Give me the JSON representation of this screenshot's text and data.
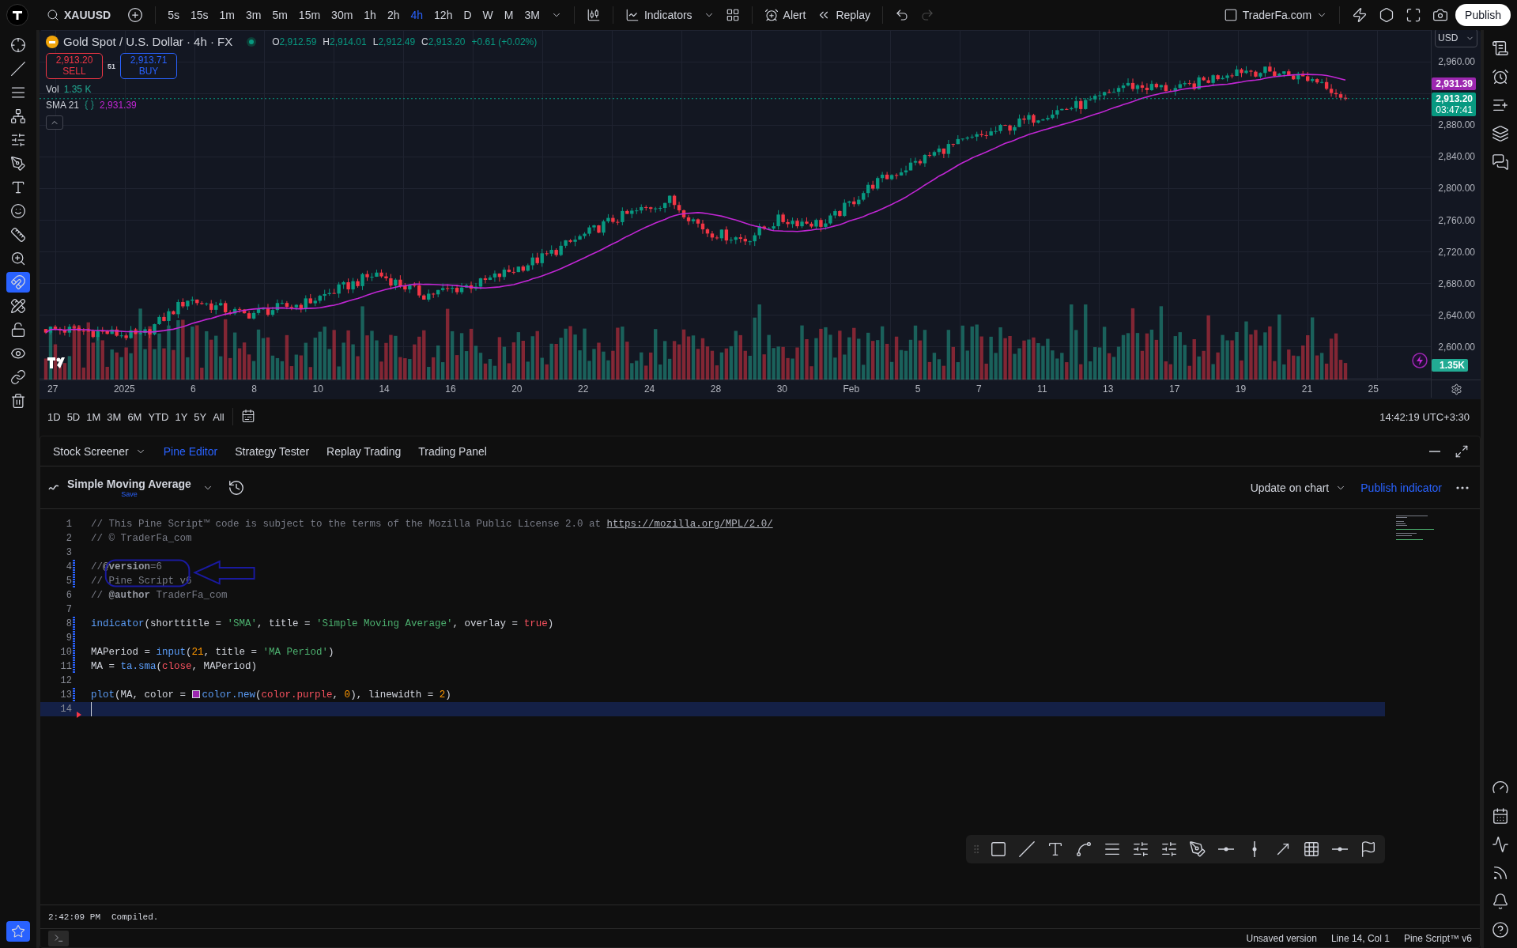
{
  "toolbar": {
    "symbol": "XAUUSD",
    "intervals": [
      {
        "label": "5s",
        "selected": false
      },
      {
        "label": "15s",
        "selected": false
      },
      {
        "label": "1m",
        "selected": false
      },
      {
        "label": "3m",
        "selected": false
      },
      {
        "label": "5m",
        "selected": false
      },
      {
        "label": "15m",
        "selected": false
      },
      {
        "label": "30m",
        "selected": false
      },
      {
        "label": "1h",
        "selected": false
      },
      {
        "label": "2h",
        "selected": false
      },
      {
        "label": "4h",
        "selected": true
      },
      {
        "label": "12h",
        "selected": false
      },
      {
        "label": "D",
        "selected": false
      },
      {
        "label": "W",
        "selected": false
      },
      {
        "label": "M",
        "selected": false
      },
      {
        "label": "3M",
        "selected": false
      }
    ],
    "indicators": "Indicators",
    "alert": "Alert",
    "replay": "Replay",
    "layout_name": "TraderFa.com",
    "publish": "Publish"
  },
  "legend": {
    "title": "Gold Spot / U.S. Dollar · 4h · FX",
    "ohlc": [
      {
        "label": "O",
        "value": "2,912.59"
      },
      {
        "label": "H",
        "value": "2,914.01"
      },
      {
        "label": "L",
        "value": "2,912.49"
      },
      {
        "label": "C",
        "value": "2,913.20"
      }
    ],
    "change": "+0.61 (+0.02%)",
    "sell": {
      "price": "2,913.20",
      "label": "SELL"
    },
    "spread": "51",
    "buy": {
      "price": "2,913.71",
      "label": "BUY"
    },
    "volume": {
      "label": "Vol",
      "value": "1.35 K"
    },
    "sma": {
      "label": "SMA 21",
      "value": "2,931.39"
    }
  },
  "price_axis": {
    "currency": "USD",
    "ticks": [
      "2,960.00",
      "2,880.00",
      "2,840.00",
      "2,800.00",
      "2,760.00",
      "2,720.00",
      "2,680.00",
      "2,640.00",
      "2,600.00"
    ],
    "sma_tag": "2,931.39",
    "last_price": "2,913.20",
    "countdown": "03:47:41",
    "volume_tag": "1.35K"
  },
  "time_axis": [
    "27",
    "2025",
    "6",
    "8",
    "10",
    "14",
    "16",
    "20",
    "22",
    "24",
    "28",
    "30",
    "Feb",
    "5",
    "7",
    "11",
    "13",
    "17",
    "19",
    "21",
    "25"
  ],
  "ranges": [
    "1D",
    "5D",
    "1M",
    "3M",
    "6M",
    "YTD",
    "1Y",
    "5Y",
    "All"
  ],
  "clock": "14:42:19 UTC+3:30",
  "bottom_tabs": [
    {
      "label": "Stock Screener",
      "selected": false,
      "dropdown": true
    },
    {
      "label": "Pine Editor",
      "selected": true,
      "dropdown": false
    },
    {
      "label": "Strategy Tester",
      "selected": false,
      "dropdown": false
    },
    {
      "label": "Replay Trading",
      "selected": false,
      "dropdown": false
    },
    {
      "label": "Trading Panel",
      "selected": false,
      "dropdown": false
    }
  ],
  "editor": {
    "script_name": "Simple Moving Average",
    "save_label": "Save",
    "update": "Update on chart",
    "publish": "Publish indicator",
    "lines": [
      {
        "number": "1",
        "changed": false,
        "current": false,
        "tokens": [
          {
            "kind": "comment",
            "text": "// This Pine Script™ code is subject to the terms of the Mozilla Public License 2.0 at "
          },
          {
            "kind": "link",
            "text": "https://mozilla.org/MPL/2.0/"
          }
        ]
      },
      {
        "number": "2",
        "changed": false,
        "current": false,
        "tokens": [
          {
            "kind": "comment",
            "text": "// © TraderFa_com"
          }
        ]
      },
      {
        "number": "3",
        "changed": false,
        "current": false
      },
      {
        "number": "4",
        "changed": true,
        "current": false,
        "tokens": [
          {
            "kind": "comment",
            "text": "//"
          },
          {
            "kind": "doc",
            "text": "@version"
          },
          {
            "kind": "comment",
            "text": "=6"
          }
        ]
      },
      {
        "number": "5",
        "changed": true,
        "current": false,
        "tokens": [
          {
            "kind": "comment",
            "text": "// Pine Script v6"
          }
        ]
      },
      {
        "number": "6",
        "changed": false,
        "current": false,
        "tokens": [
          {
            "kind": "comment",
            "text": "// "
          },
          {
            "kind": "doc",
            "text": "@author"
          },
          {
            "kind": "comment",
            "text": " TraderFa_com"
          }
        ]
      },
      {
        "number": "7",
        "changed": false,
        "current": false
      },
      {
        "number": "8",
        "changed": true,
        "current": false,
        "tokens": [
          {
            "kind": "func",
            "text": "indicator"
          },
          {
            "kind": "plain",
            "text": "(shorttitle = "
          },
          {
            "kind": "string",
            "text": "'SMA'"
          },
          {
            "kind": "plain",
            "text": ", title = "
          },
          {
            "kind": "string",
            "text": "'Simple Moving Average'"
          },
          {
            "kind": "plain",
            "text": ", overlay = "
          },
          {
            "kind": "constant",
            "text": "true"
          },
          {
            "kind": "plain",
            "text": ")"
          }
        ]
      },
      {
        "number": "9",
        "changed": true,
        "current": false
      },
      {
        "number": "10",
        "changed": true,
        "current": false,
        "tokens": [
          {
            "kind": "plain",
            "text": "MAPeriod = "
          },
          {
            "kind": "func",
            "text": "input"
          },
          {
            "kind": "plain",
            "text": "("
          },
          {
            "kind": "number",
            "text": "21"
          },
          {
            "kind": "plain",
            "text": ", title = "
          },
          {
            "kind": "string",
            "text": "'MA Period'"
          },
          {
            "kind": "plain",
            "text": ")"
          }
        ]
      },
      {
        "number": "11",
        "changed": true,
        "current": false,
        "tokens": [
          {
            "kind": "plain",
            "text": "MA = "
          },
          {
            "kind": "func",
            "text": "ta.sma"
          },
          {
            "kind": "plain",
            "text": "("
          },
          {
            "kind": "constant",
            "text": "close"
          },
          {
            "kind": "plain",
            "text": ", MAPeriod)"
          }
        ]
      },
      {
        "number": "12",
        "changed": false,
        "current": false
      },
      {
        "number": "13",
        "changed": true,
        "current": false,
        "tokens": [
          {
            "kind": "func",
            "text": "plot"
          },
          {
            "kind": "plain",
            "text": "(MA, color = "
          },
          {
            "kind": "swatch"
          },
          {
            "kind": "func",
            "text": "color.new"
          },
          {
            "kind": "plain",
            "text": "("
          },
          {
            "kind": "constant",
            "text": "color.purple"
          },
          {
            "kind": "plain",
            "text": ", "
          },
          {
            "kind": "number",
            "text": "0"
          },
          {
            "kind": "plain",
            "text": "), linewidth = "
          },
          {
            "kind": "number",
            "text": "2"
          },
          {
            "kind": "plain",
            "text": ")"
          }
        ]
      },
      {
        "number": "14",
        "changed": false,
        "current": true
      }
    ]
  },
  "console": {
    "time": "2:42:09 PM",
    "message": "Compiled."
  },
  "status_bar": [
    "Unsaved version",
    "Line 14, Col 1",
    "Pine Script™ v6"
  ]
}
